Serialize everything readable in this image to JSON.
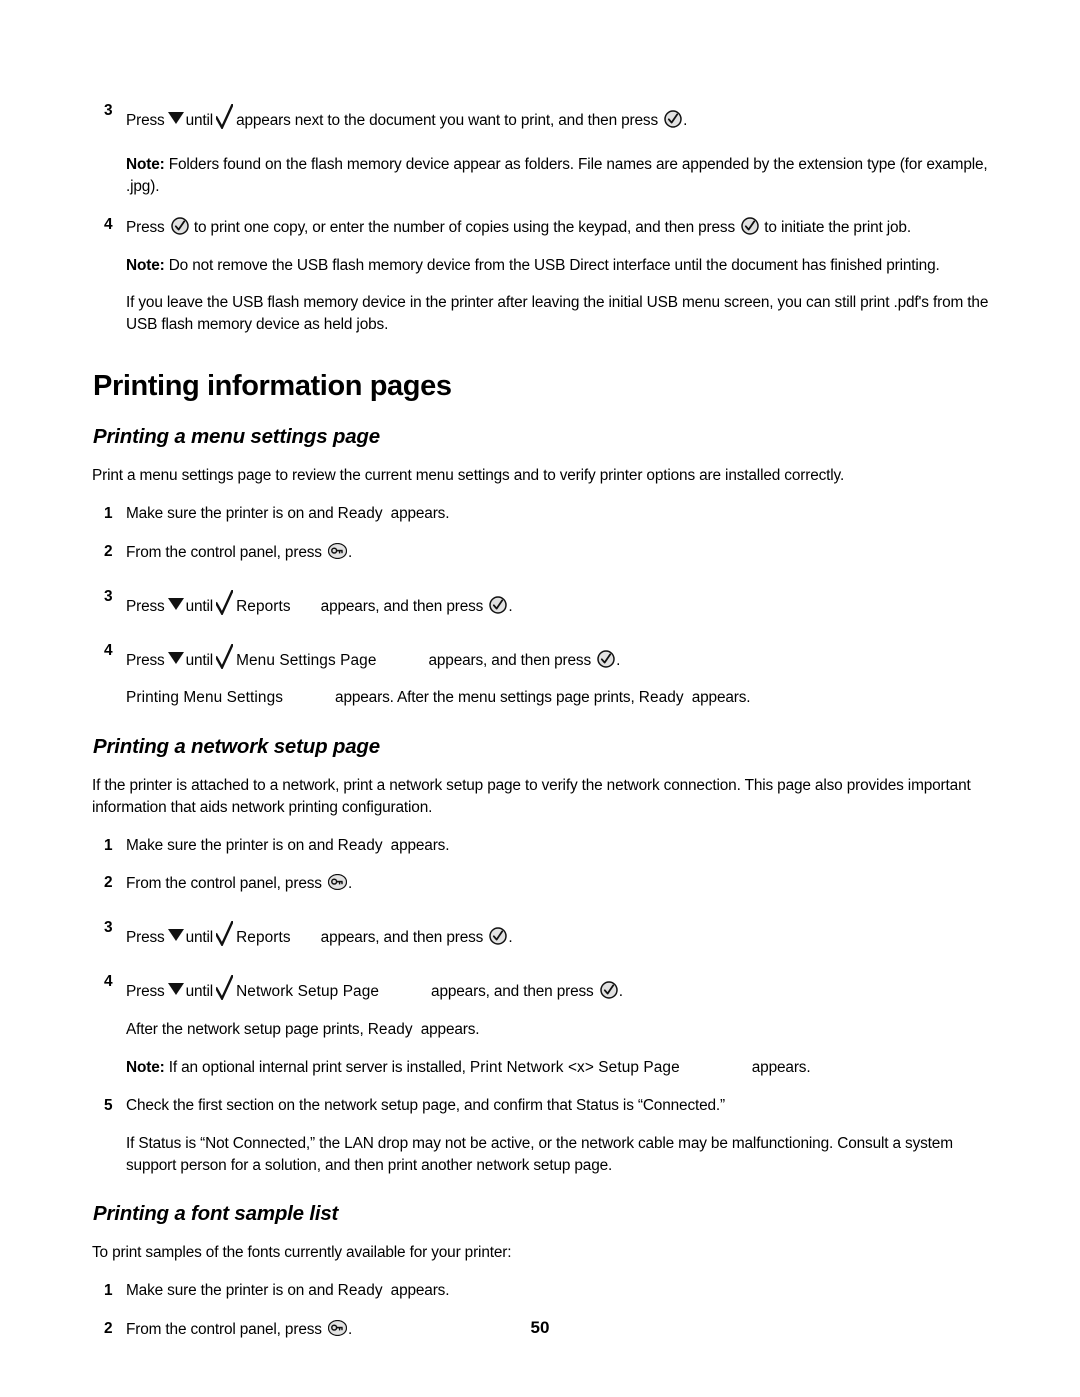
{
  "document": {
    "page_number": "50",
    "section_heading": "Printing information pages"
  },
  "usb_steps": {
    "step3": {
      "num": "3",
      "press_label": "Press",
      "until_label": "until",
      "after_check": "appears next to the document you want to print, and then press",
      "period": "."
    },
    "note1": {
      "label": "Note:",
      "text": "Folders found on the flash memory device appear as folders. File names are appended by the extension type (for example, .jpg)."
    },
    "step4": {
      "num": "4",
      "press_label": "Press",
      "mid_text": "to print one copy, or enter the number of copies using the keypad, and then press",
      "end_text": "to initiate the print job."
    },
    "note2": {
      "label": "Note:",
      "text": "Do not remove the USB flash memory device from the USB Direct interface until the document has finished printing."
    },
    "trailing_para": "If you leave the USB flash memory device in the printer after leaving the initial USB menu screen, you can still print .pdf's from the USB flash memory device as held jobs."
  },
  "menu_settings": {
    "heading": "Printing a menu settings page",
    "intro": "Print a menu settings page to review the current menu settings and to verify printer options are installed correctly.",
    "step1": {
      "num": "1",
      "before": "Make sure the printer is on and",
      "display": "Ready",
      "after": "appears."
    },
    "step2": {
      "num": "2",
      "before": "From the control panel, press",
      "after": "."
    },
    "step3": {
      "num": "3",
      "press_label": "Press",
      "until_label": "until",
      "display": "Reports",
      "after": "appears, and then press",
      "period": "."
    },
    "step4": {
      "num": "4",
      "press_label": "Press",
      "until_label": "until",
      "display": "Menu Settings Page",
      "after": "appears, and then press",
      "period": "."
    },
    "result": {
      "display": "Printing Menu Settings",
      "middle": "appears. After the menu settings page prints,",
      "display2": "Ready",
      "end": "appears."
    }
  },
  "network_setup": {
    "heading": "Printing a network setup page",
    "intro": "If the printer is attached to a network, print a network setup page to verify the network connection. This page also provides important information that aids network printing configuration.",
    "step1": {
      "num": "1",
      "before": "Make sure the printer is on and",
      "display": "Ready",
      "after": "appears."
    },
    "step2": {
      "num": "2",
      "before": "From the control panel, press",
      "after": "."
    },
    "step3": {
      "num": "3",
      "press_label": "Press",
      "until_label": "until",
      "display": "Reports",
      "after": "appears, and then press",
      "period": "."
    },
    "step4": {
      "num": "4",
      "press_label": "Press",
      "until_label": "until",
      "display": "Network Setup Page",
      "after": "appears, and then press",
      "period": "."
    },
    "result": {
      "before": "After the network setup page prints,",
      "display": "Ready",
      "after": "appears."
    },
    "note": {
      "label": "Note:",
      "before": "If an optional internal print server is installed,",
      "display": "Print Network <x> Setup Page",
      "after": "appears."
    },
    "step5": {
      "num": "5",
      "text": "Check the first section on the network setup page, and confirm that Status is “Connected.”"
    },
    "step5_cont": "If Status is “Not Connected,” the LAN drop may not be active, or the network cable may be malfunctioning. Consult a system support person for a solution, and then print another network setup page."
  },
  "font_sample": {
    "heading": "Printing a font sample list",
    "intro": "To print samples of the fonts currently available for your printer:",
    "step1": {
      "num": "1",
      "before": "Make sure the printer is on and",
      "display": "Ready",
      "after": "appears."
    },
    "step2": {
      "num": "2",
      "before": "From the control panel, press",
      "after": "."
    }
  },
  "icons": {
    "down_arrow": "down-arrow-icon",
    "check": "checkmark-icon",
    "select": "select-button-icon",
    "menu_key": "menu-key-icon"
  }
}
